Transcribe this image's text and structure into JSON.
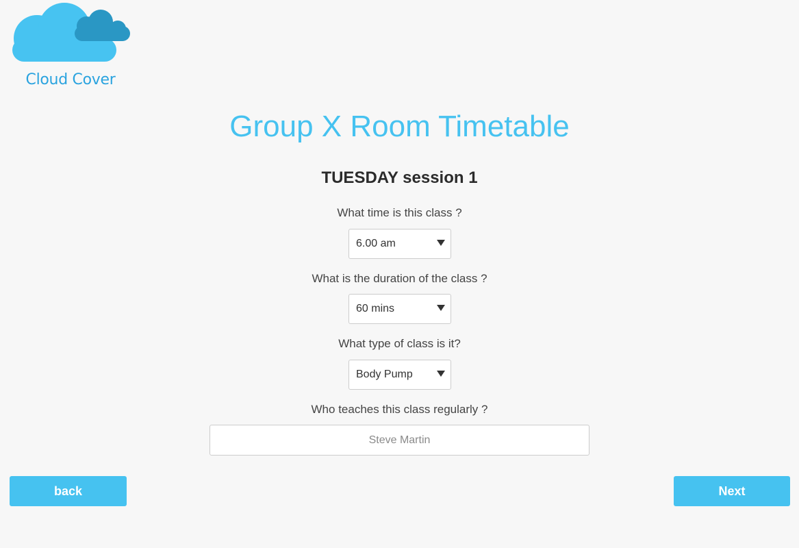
{
  "brand": {
    "name": "Cloud Cover",
    "colors": {
      "cloud_light": "#47c3f1",
      "cloud_dark": "#2a97c4",
      "text": "#2aa3df"
    }
  },
  "page": {
    "title": "Group X Room Timetable",
    "subtitle": "TUESDAY session 1"
  },
  "form": {
    "time": {
      "label": "What time is this class ?",
      "value": "6.00 am"
    },
    "duration": {
      "label": "What is the duration of the class ?",
      "value": "60 mins"
    },
    "type": {
      "label": "What type of class is it?",
      "value": "Body Pump"
    },
    "teacher": {
      "label": "Who teaches this class regularly ?",
      "placeholder": "Steve Martin"
    }
  },
  "nav": {
    "back_label": "back",
    "next_label": "Next"
  },
  "colors": {
    "accent": "#46c2f0",
    "background": "#f7f7f7"
  }
}
